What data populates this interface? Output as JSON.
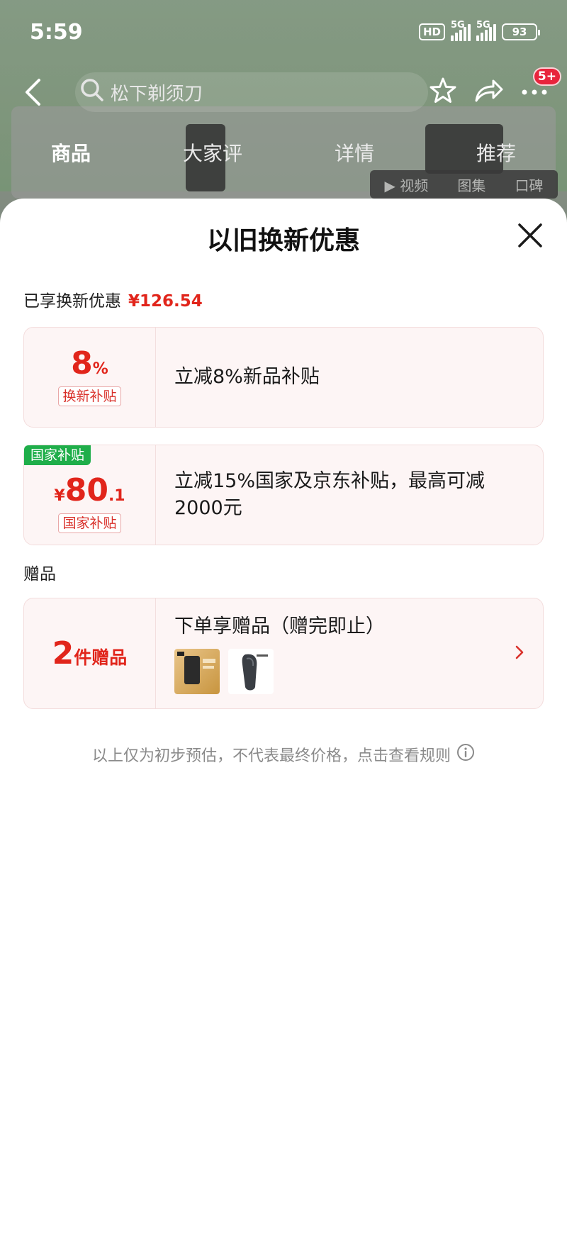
{
  "status": {
    "time": "5:59",
    "hd": "HD",
    "sim1": "5G",
    "sim2": "5G",
    "battery": "93"
  },
  "nav": {
    "search_text": "松下剃须刀",
    "badge": "5+"
  },
  "tabs": [
    "商品",
    "大家评",
    "详情",
    "推荐"
  ],
  "background": {
    "media_labels": [
      "▶ 视频",
      "图集",
      "口碑"
    ]
  },
  "sheet": {
    "title": "以旧换新优惠",
    "enjoyed_label": "已享换新优惠",
    "enjoyed_amount": "¥126.54",
    "offers": [
      {
        "value": "8",
        "unit": "%",
        "tag": "换新补贴",
        "description": "立减8%新品补贴"
      },
      {
        "corner_tag": "国家补贴",
        "currency": "¥",
        "value": "80",
        "decimal": ".1",
        "tag": "国家补贴",
        "description": "立减15%国家及京东补贴，最高可减2000元"
      }
    ],
    "gifts_section_label": "赠品",
    "gift": {
      "count": "2",
      "unit": "件赠品",
      "description": "下单享赠品（赠完即止）",
      "thumb_names": [
        "gift-thumb-box",
        "gift-thumb-pouch"
      ]
    },
    "footnote": "以上仅为初步预估，不代表最终价格，点击查看规则"
  },
  "colors": {
    "accent_red": "#e1251b",
    "tag_green": "#1fae4a",
    "card_bg": "#fdf5f5"
  }
}
